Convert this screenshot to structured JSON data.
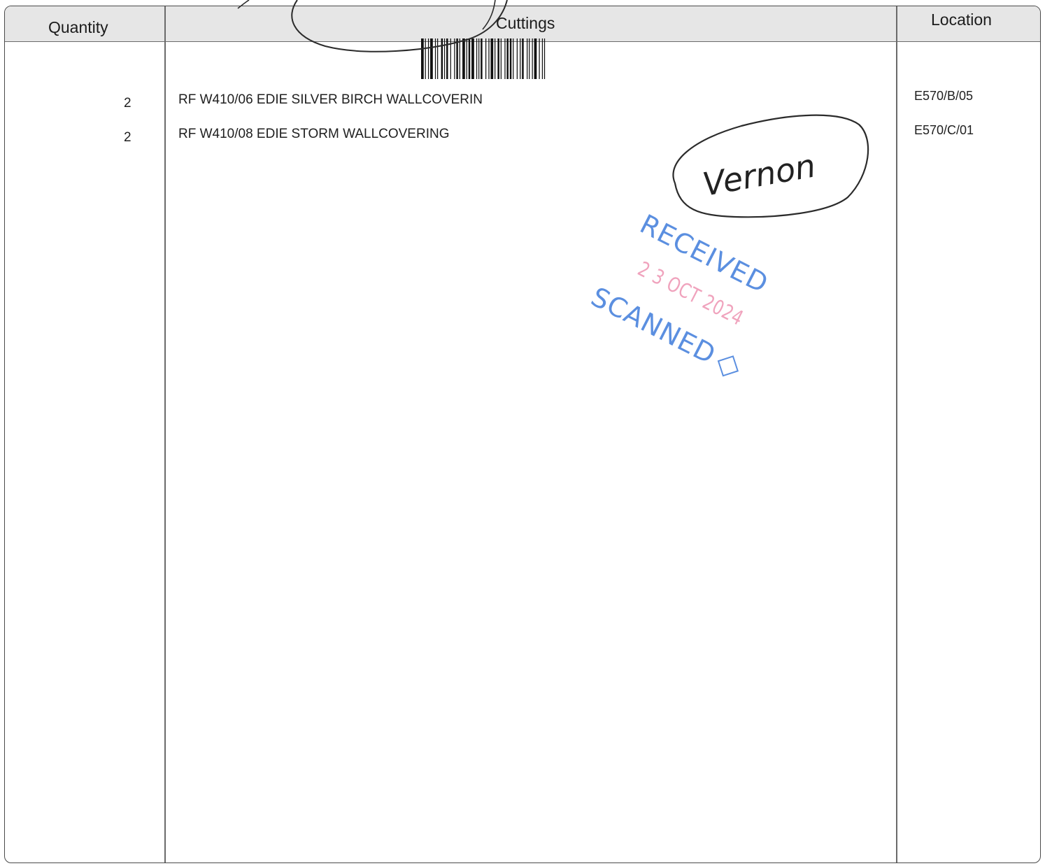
{
  "table": {
    "headers": {
      "quantity": "Quantity",
      "cuttings": "Cuttings",
      "location": "Location"
    },
    "rows": [
      {
        "quantity": "2",
        "description": "RF W410/06 EDIE SILVER BIRCH WALLCOVERIN",
        "location": "E570/B/05"
      },
      {
        "quantity": "2",
        "description": "RF W410/08 EDIE STORM WALLCOVERING",
        "location": "E570/C/01"
      }
    ]
  },
  "handwriting": {
    "name": "Vernon"
  },
  "stamps": {
    "received": "RECEIVED",
    "date": "2 3 OCT 2024",
    "scanned": "SCANNED"
  },
  "colors": {
    "header_fill": "#e6e6e6",
    "stamp_blue": "#5b8fe0",
    "stamp_pink": "#f0a3bd",
    "ink": "#1a1a1a"
  }
}
